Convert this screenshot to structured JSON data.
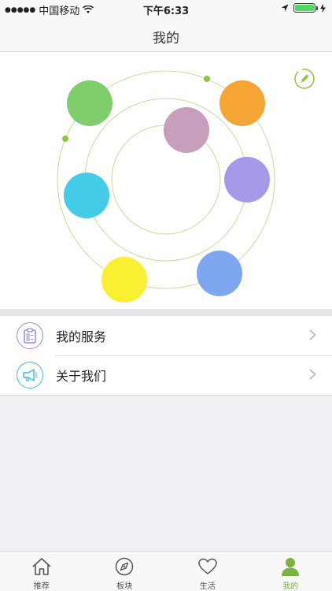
{
  "status_bar": {
    "signal": "●●●●●",
    "carrier": "中国移动",
    "time": "下午6:33"
  },
  "nav": {
    "title": "我的"
  },
  "orbit": {
    "colors": {
      "green": "#7fce6b",
      "orange": "#f5a533",
      "mauve": "#c79fbd",
      "purple": "#a898ea",
      "cyan": "#44cbe8",
      "yellow": "#fbef31",
      "blue": "#7fa7f0",
      "ring": "#c8dc9a",
      "dot": "#8dc63f"
    }
  },
  "menu": {
    "items": [
      {
        "label": "我的服务",
        "icon": "clipboard-icon",
        "color": "#9a88d9"
      },
      {
        "label": "关于我们",
        "icon": "megaphone-icon",
        "color": "#3bbbe0"
      }
    ]
  },
  "tabs": [
    {
      "label": "推荐",
      "icon": "home-icon"
    },
    {
      "label": "板块",
      "icon": "compass-icon"
    },
    {
      "label": "生活",
      "icon": "heart-icon"
    },
    {
      "label": "我的",
      "icon": "person-icon",
      "active": true
    }
  ],
  "accent": "#7cb342"
}
